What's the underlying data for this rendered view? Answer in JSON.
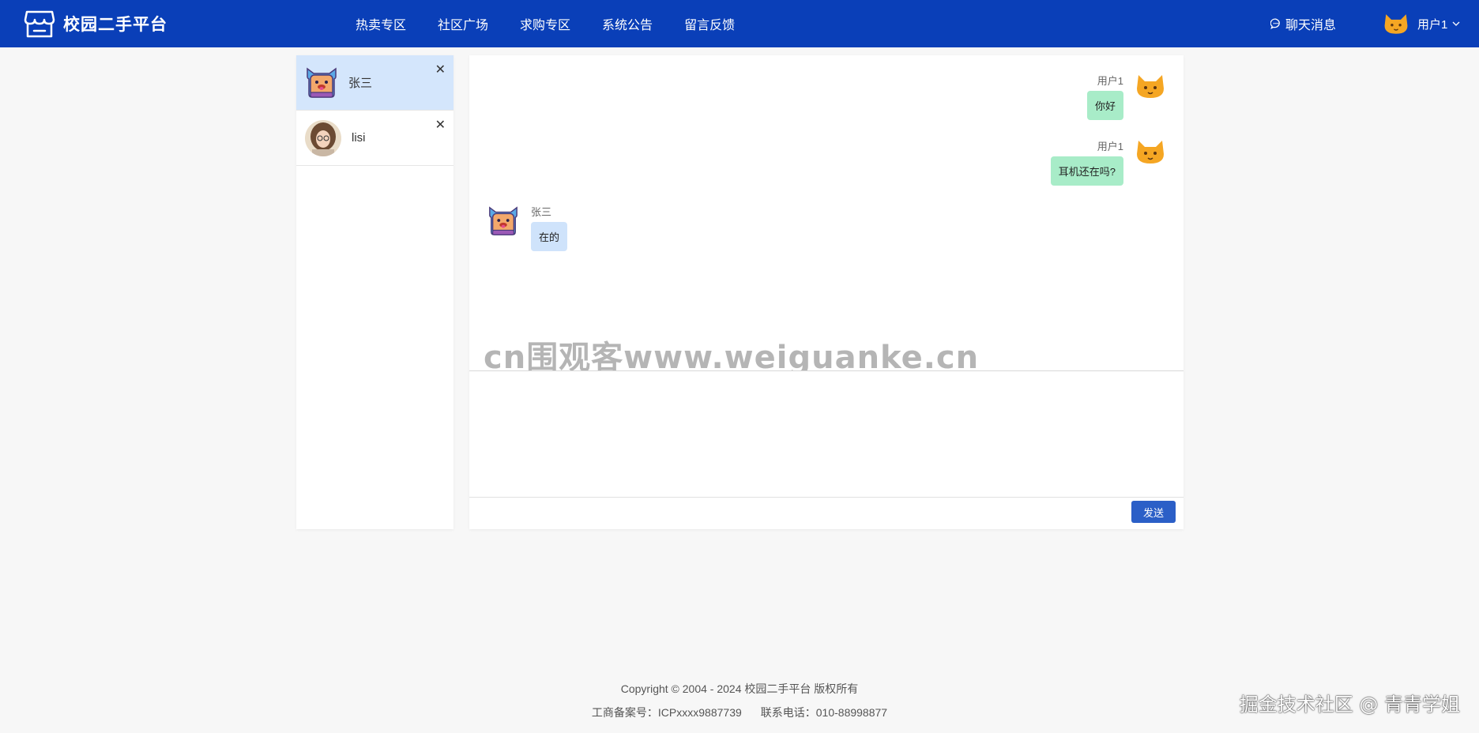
{
  "header": {
    "brand": "校园二手平台",
    "nav": [
      "热卖专区",
      "社区广场",
      "求购专区",
      "系统公告",
      "留言反馈"
    ],
    "chat_link": "聊天消息",
    "user_name": "用户1",
    "colors": {
      "bar": "#0a3fb8"
    }
  },
  "contacts": [
    {
      "name": "张三",
      "active": true,
      "avatar": "cat-monster-avatar"
    },
    {
      "name": "lisi",
      "active": false,
      "avatar": "girl-photo-avatar"
    }
  ],
  "messages": [
    {
      "sender": "用户1",
      "text": "你好",
      "mine": true
    },
    {
      "sender": "用户1",
      "text": "耳机还在吗?",
      "mine": true
    },
    {
      "sender": "张三",
      "text": "在的",
      "mine": false
    }
  ],
  "watermark": "cn围观客www.weiguanke.cn",
  "composer": {
    "value": "",
    "send_label": "发送"
  },
  "footer": {
    "copyright": "Copyright © 2004 - 2024 校园二手平台 版权所有",
    "icp": "工商备案号：ICPxxxx9887739",
    "phone": "联系电话：010-88998877"
  },
  "corner_watermark": "掘金技术社区 @ 青青学姐"
}
